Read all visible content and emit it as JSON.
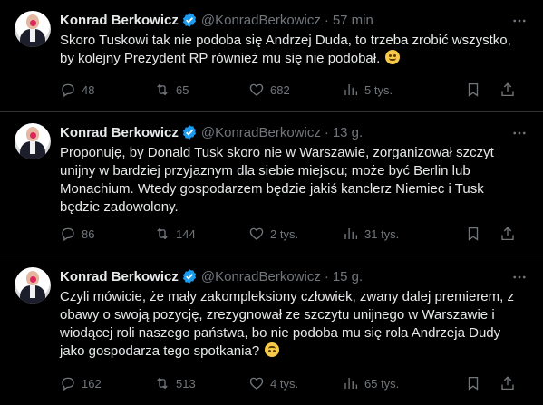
{
  "colors": {
    "background": "#000000",
    "text": "#e7e9ea",
    "muted": "#71767b",
    "verified": "#1d9bf0",
    "divider": "#2f3336"
  },
  "tweets": [
    {
      "author": "Konrad Berkowicz",
      "handle": "@KonradBerkowicz",
      "separator": "·",
      "time": "57 min",
      "text": "Skoro Tuskowi tak nie podoba się Andrzej Duda, to trzeba zrobić wszystko, by kolejny Prezydent RP również mu się nie podobał.",
      "emoji": "wink-emoji",
      "replies": "48",
      "retweets": "65",
      "likes": "682",
      "views": "5 tys."
    },
    {
      "author": "Konrad Berkowicz",
      "handle": "@KonradBerkowicz",
      "separator": "·",
      "time": "13 g.",
      "text": "Proponuję, by Donald Tusk skoro nie w Warszawie, zorganizował szczyt unijny w bardziej przyjaznym dla siebie miejscu; może być Berlin lub Monachium. Wtedy gospodarzem będzie jakiś kanclerz Niemiec i Tusk będzie zadowolony.",
      "replies": "86",
      "retweets": "144",
      "likes": "2 tys.",
      "views": "31 tys."
    },
    {
      "author": "Konrad Berkowicz",
      "handle": "@KonradBerkowicz",
      "separator": "·",
      "time": "15 g.",
      "text": "Czyli mówicie, że mały zakompleksiony człowiek, zwany dalej premierem, z obawy o swoją pozycję, zrezygnował ze szczytu unijnego w Warszawie i wiodącej roli naszego państwa, bo nie podoba mu się rola Andrzeja Dudy jako gospodarza tego spotkania?",
      "emoji": "upside-down-face-emoji",
      "replies": "162",
      "retweets": "513",
      "likes": "4 tys.",
      "views": "65 tys."
    }
  ]
}
